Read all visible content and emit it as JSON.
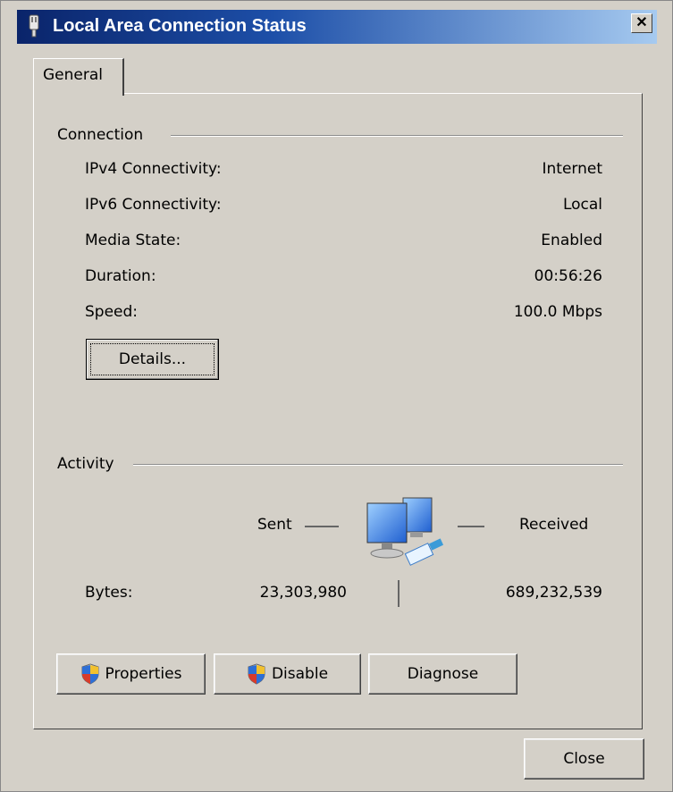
{
  "window": {
    "title": "Local Area Connection Status",
    "close_glyph": "✕"
  },
  "tabs": [
    {
      "label": "General"
    }
  ],
  "connection": {
    "group_label": "Connection",
    "rows": [
      {
        "label": "IPv4 Connectivity:",
        "value": "Internet"
      },
      {
        "label": "IPv6 Connectivity:",
        "value": "Local"
      },
      {
        "label": "Media State:",
        "value": "Enabled"
      },
      {
        "label": "Duration:",
        "value": "00:56:26"
      },
      {
        "label": "Speed:",
        "value": "100.0 Mbps"
      }
    ],
    "details_button": "Details..."
  },
  "activity": {
    "group_label": "Activity",
    "sent_label": "Sent",
    "received_label": "Received",
    "bytes_label": "Bytes:",
    "bytes_sent": "23,303,980",
    "bytes_received": "689,232,539",
    "icon": "network-computers-icon"
  },
  "buttons": {
    "properties": "Properties",
    "disable": "Disable",
    "diagnose": "Diagnose",
    "close": "Close"
  },
  "colors": {
    "face": "#d4d0c8",
    "title_start": "#0a246a",
    "title_end": "#a6caf0"
  }
}
